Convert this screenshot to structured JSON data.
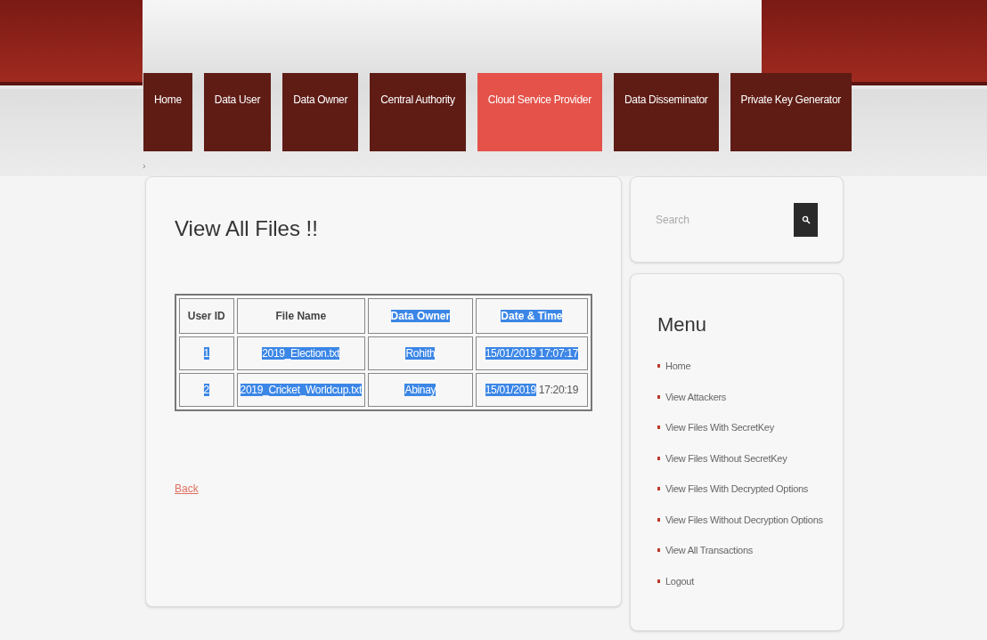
{
  "nav": [
    {
      "label": "Home",
      "selected": false
    },
    {
      "label": "Data User",
      "selected": false
    },
    {
      "label": "Data Owner",
      "selected": false
    },
    {
      "label": "Central Authority",
      "selected": false
    },
    {
      "label": "Cloud Service Provider",
      "selected": true
    },
    {
      "label": "Data Disseminator",
      "selected": false
    },
    {
      "label": "Private Key Generator",
      "selected": false
    }
  ],
  "breadcrumb": "›",
  "main": {
    "title": "View All Files !!",
    "table": {
      "columns": [
        {
          "text": "User ID",
          "selected": false
        },
        {
          "text": "File Name",
          "selected": false
        },
        {
          "text": "Data Owner",
          "selected": true
        },
        {
          "text": "Date & Time",
          "selected": true
        }
      ],
      "rows": [
        [
          {
            "segments": [
              {
                "text": "1",
                "selected": true
              }
            ]
          },
          {
            "segments": [
              {
                "text": "2019_Election.txt",
                "selected": true
              }
            ]
          },
          {
            "segments": [
              {
                "text": "Rohith",
                "selected": true
              }
            ]
          },
          {
            "segments": [
              {
                "text": "15/01/2019 17:07:17",
                "selected": true
              }
            ]
          }
        ],
        [
          {
            "segments": [
              {
                "text": "2",
                "selected": true
              }
            ]
          },
          {
            "segments": [
              {
                "text": "2019_Cricket_Worldcup.txt",
                "selected": true
              }
            ]
          },
          {
            "segments": [
              {
                "text": "Abinay",
                "selected": true
              }
            ]
          },
          {
            "segments": [
              {
                "text": "15/01/2019",
                "selected": true
              },
              {
                "text": " 17:20:19",
                "selected": false
              }
            ]
          }
        ]
      ]
    },
    "back_link": "Back"
  },
  "search": {
    "placeholder": "Search"
  },
  "menu": {
    "title": "Menu",
    "items": [
      "Home",
      "View Attackers",
      "View Files With SecretKey",
      "View Files Without SecretKey",
      "View Files With Decrypted Options",
      "View Files Without Decryption Options",
      "View All Transactions",
      "Logout"
    ]
  }
}
